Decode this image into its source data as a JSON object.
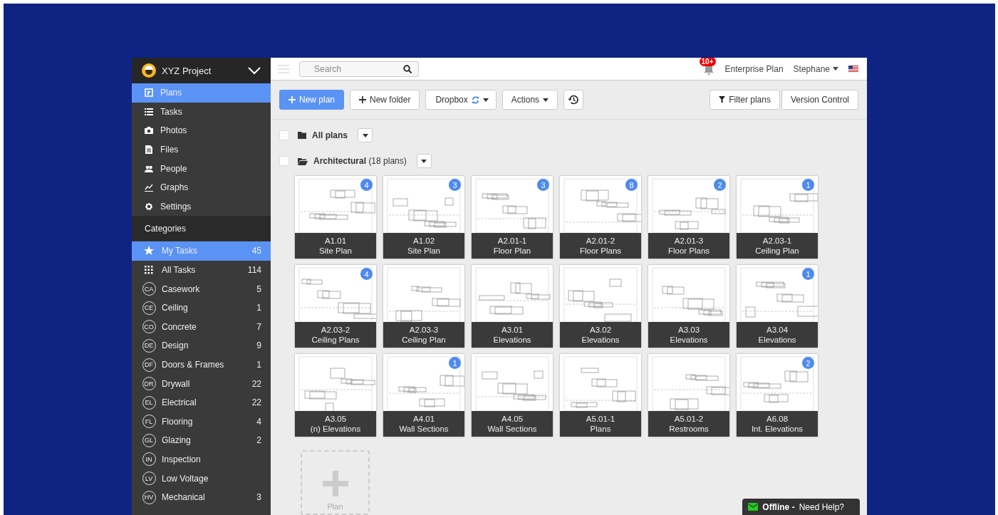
{
  "project": {
    "name": "XYZ Project"
  },
  "nav": [
    {
      "kind": "plans",
      "label": "Plans",
      "selected": true
    },
    {
      "kind": "tasks",
      "label": "Tasks",
      "selected": false
    },
    {
      "kind": "photos",
      "label": "Photos",
      "selected": false
    },
    {
      "kind": "files",
      "label": "Files",
      "selected": false
    },
    {
      "kind": "people",
      "label": "People",
      "selected": false
    },
    {
      "kind": "graphs",
      "label": "Graphs",
      "selected": false
    },
    {
      "kind": "settings",
      "label": "Settings",
      "selected": false
    }
  ],
  "categories_title": "Categories",
  "categories": [
    {
      "kind": "star",
      "name": "My Tasks",
      "count": "45",
      "selected": true
    },
    {
      "kind": "grid",
      "name": "All Tasks",
      "count": "114",
      "selected": false
    },
    {
      "kind": "abbr",
      "abbr": "CA",
      "name": "Casework",
      "count": "5",
      "selected": false
    },
    {
      "kind": "abbr",
      "abbr": "CE",
      "name": "Ceiling",
      "count": "1",
      "selected": false
    },
    {
      "kind": "abbr",
      "abbr": "CO",
      "name": "Concrete",
      "count": "7",
      "selected": false
    },
    {
      "kind": "abbr",
      "abbr": "DE",
      "name": "Design",
      "count": "9",
      "selected": false
    },
    {
      "kind": "abbr",
      "abbr": "DF",
      "name": "Doors & Frames",
      "count": "1",
      "selected": false
    },
    {
      "kind": "abbr",
      "abbr": "DR",
      "name": "Drywall",
      "count": "22",
      "selected": false
    },
    {
      "kind": "abbr",
      "abbr": "EL",
      "name": "Electrical",
      "count": "22",
      "selected": false
    },
    {
      "kind": "abbr",
      "abbr": "FL",
      "name": "Flooring",
      "count": "4",
      "selected": false
    },
    {
      "kind": "abbr",
      "abbr": "GL",
      "name": "Glazing",
      "count": "2",
      "selected": false
    },
    {
      "kind": "abbr",
      "abbr": "IN",
      "name": "Inspection",
      "selected": false
    },
    {
      "kind": "abbr",
      "abbr": "LV",
      "name": "Low Voltage",
      "selected": false
    },
    {
      "kind": "abbr",
      "abbr": "HV",
      "name": "Mechanical",
      "count": "3",
      "selected": false
    }
  ],
  "header": {
    "search_placeholder": "Search",
    "notifications": "10+",
    "plan": "Enterprise Plan",
    "user": "Stephane"
  },
  "toolbar": {
    "new_plan": "New plan",
    "new_folder": "New folder",
    "dropbox": "Dropbox",
    "actions": "Actions",
    "filter": "Filter plans",
    "version": "Version Control"
  },
  "folders": [
    {
      "kind": "closed",
      "name": "All plans",
      "checked": false
    },
    {
      "kind": "open",
      "name": "Architectural",
      "note": "(18 plans)",
      "checked": false
    }
  ],
  "plans": [
    {
      "code": "A1.01",
      "title": "Site Plan",
      "badge": "4"
    },
    {
      "code": "A1.02",
      "title": "Site Plan",
      "badge": "3"
    },
    {
      "code": "A2.01-1",
      "title": "Floor Plan",
      "badge": "3"
    },
    {
      "code": "A2.01-2",
      "title": "Floor Plans",
      "badge": "8"
    },
    {
      "code": "A2.01-3",
      "title": "Floor Plans",
      "badge": "2"
    },
    {
      "code": "A2.03-1",
      "title": "Ceiling Plan",
      "badge": "1"
    },
    {
      "code": "A2.03-2",
      "title": "Ceiling Plans",
      "badge": "4"
    },
    {
      "code": "A2.03-3",
      "title": "Ceiling Plan"
    },
    {
      "code": "A3.01",
      "title": "Elevations"
    },
    {
      "code": "A3.02",
      "title": "Elevations"
    },
    {
      "code": "A3.03",
      "title": "Elevations"
    },
    {
      "code": "A3.04",
      "title": "Elevations",
      "badge": "1"
    },
    {
      "code": "A3.05",
      "title": "(n) Elevations"
    },
    {
      "code": "A4.01",
      "title": "Wall Sections",
      "badge": "1"
    },
    {
      "code": "A4.05",
      "title": "Wall Sections"
    },
    {
      "code": "A5.01-1",
      "title": "Plans"
    },
    {
      "code": "A5.01-2",
      "title": "Restrooms"
    },
    {
      "code": "A6.08",
      "title": "Int. Elevations",
      "badge": "2"
    }
  ],
  "add_plan": "Plan",
  "help": {
    "status": "Offline -",
    "text": "Need Help?"
  }
}
